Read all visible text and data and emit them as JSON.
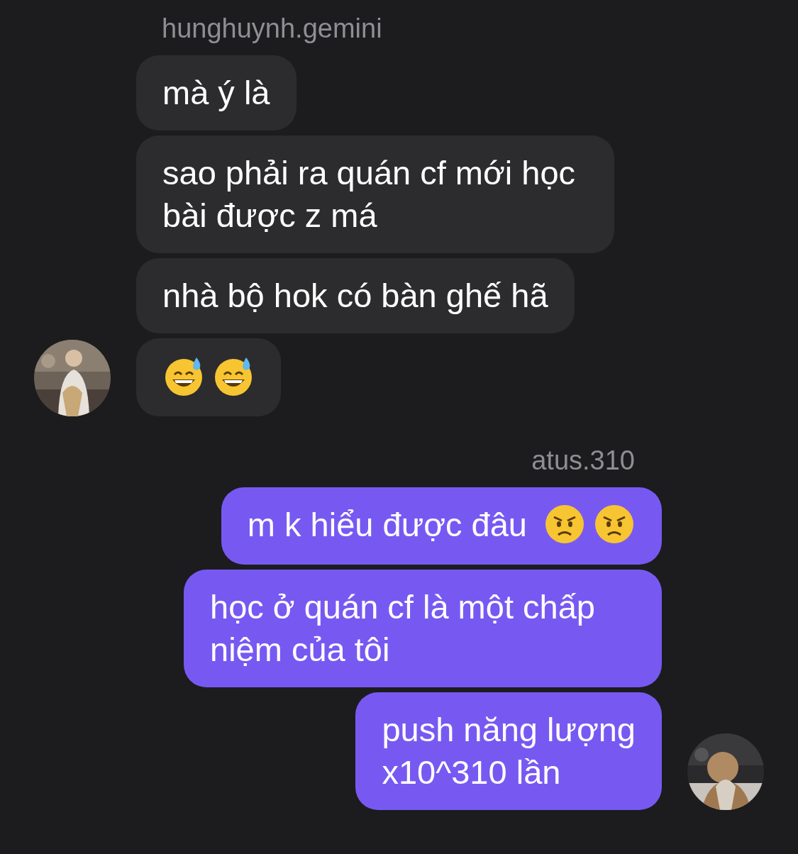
{
  "groups": [
    {
      "outgoing": false,
      "sender": "hunghuynh.gemini",
      "avatar": {
        "kind": "picture"
      },
      "messages": [
        {
          "text": "mà ý là"
        },
        {
          "text": "sao phải ra quán cf mới học bài được z má"
        },
        {
          "text": "nhà bộ hok có bàn ghế hã"
        },
        {
          "emojis": [
            {
              "kind": "sweat_smile"
            },
            {
              "kind": "sweat_smile"
            }
          ]
        }
      ]
    },
    {
      "outgoing": true,
      "sender": "atus.310",
      "avatar": {
        "kind": "picture"
      },
      "messages": [
        {
          "text": "m k hiểu được đâu",
          "emojis": [
            {
              "kind": "angry"
            },
            {
              "kind": "angry"
            }
          ]
        },
        {
          "text": "học ở quán cf là một chấp niệm của tôi"
        },
        {
          "text": "push năng lượng\nx10^310 lần"
        }
      ]
    }
  ]
}
